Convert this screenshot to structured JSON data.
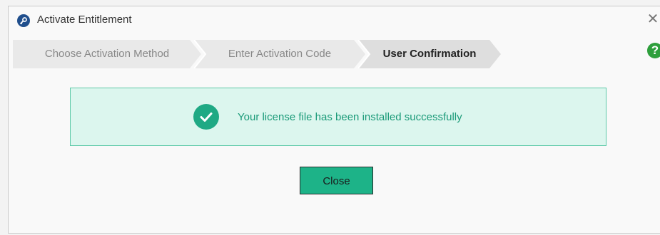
{
  "window": {
    "title": "Activate Entitlement",
    "title_icon": "key-icon",
    "close_icon": "close-icon",
    "close_glyph": "✕"
  },
  "steps": [
    {
      "label": "Choose Activation Method",
      "state": "done"
    },
    {
      "label": "Enter Activation Code",
      "state": "done"
    },
    {
      "label": "User Confirmation",
      "state": "active"
    }
  ],
  "help": {
    "glyph": "?",
    "icon": "help-icon"
  },
  "message": {
    "text": "Your license file has been installed successfully",
    "icon": "check-circle-icon"
  },
  "buttons": {
    "close_label": "Close"
  },
  "colors": {
    "accent": "#1db388",
    "success_bg": "#dcf6ee",
    "success_border": "#5cc9a7",
    "success_text": "#1a9a78",
    "help": "#2e9f3c",
    "title_icon": "#1f4e8c"
  }
}
